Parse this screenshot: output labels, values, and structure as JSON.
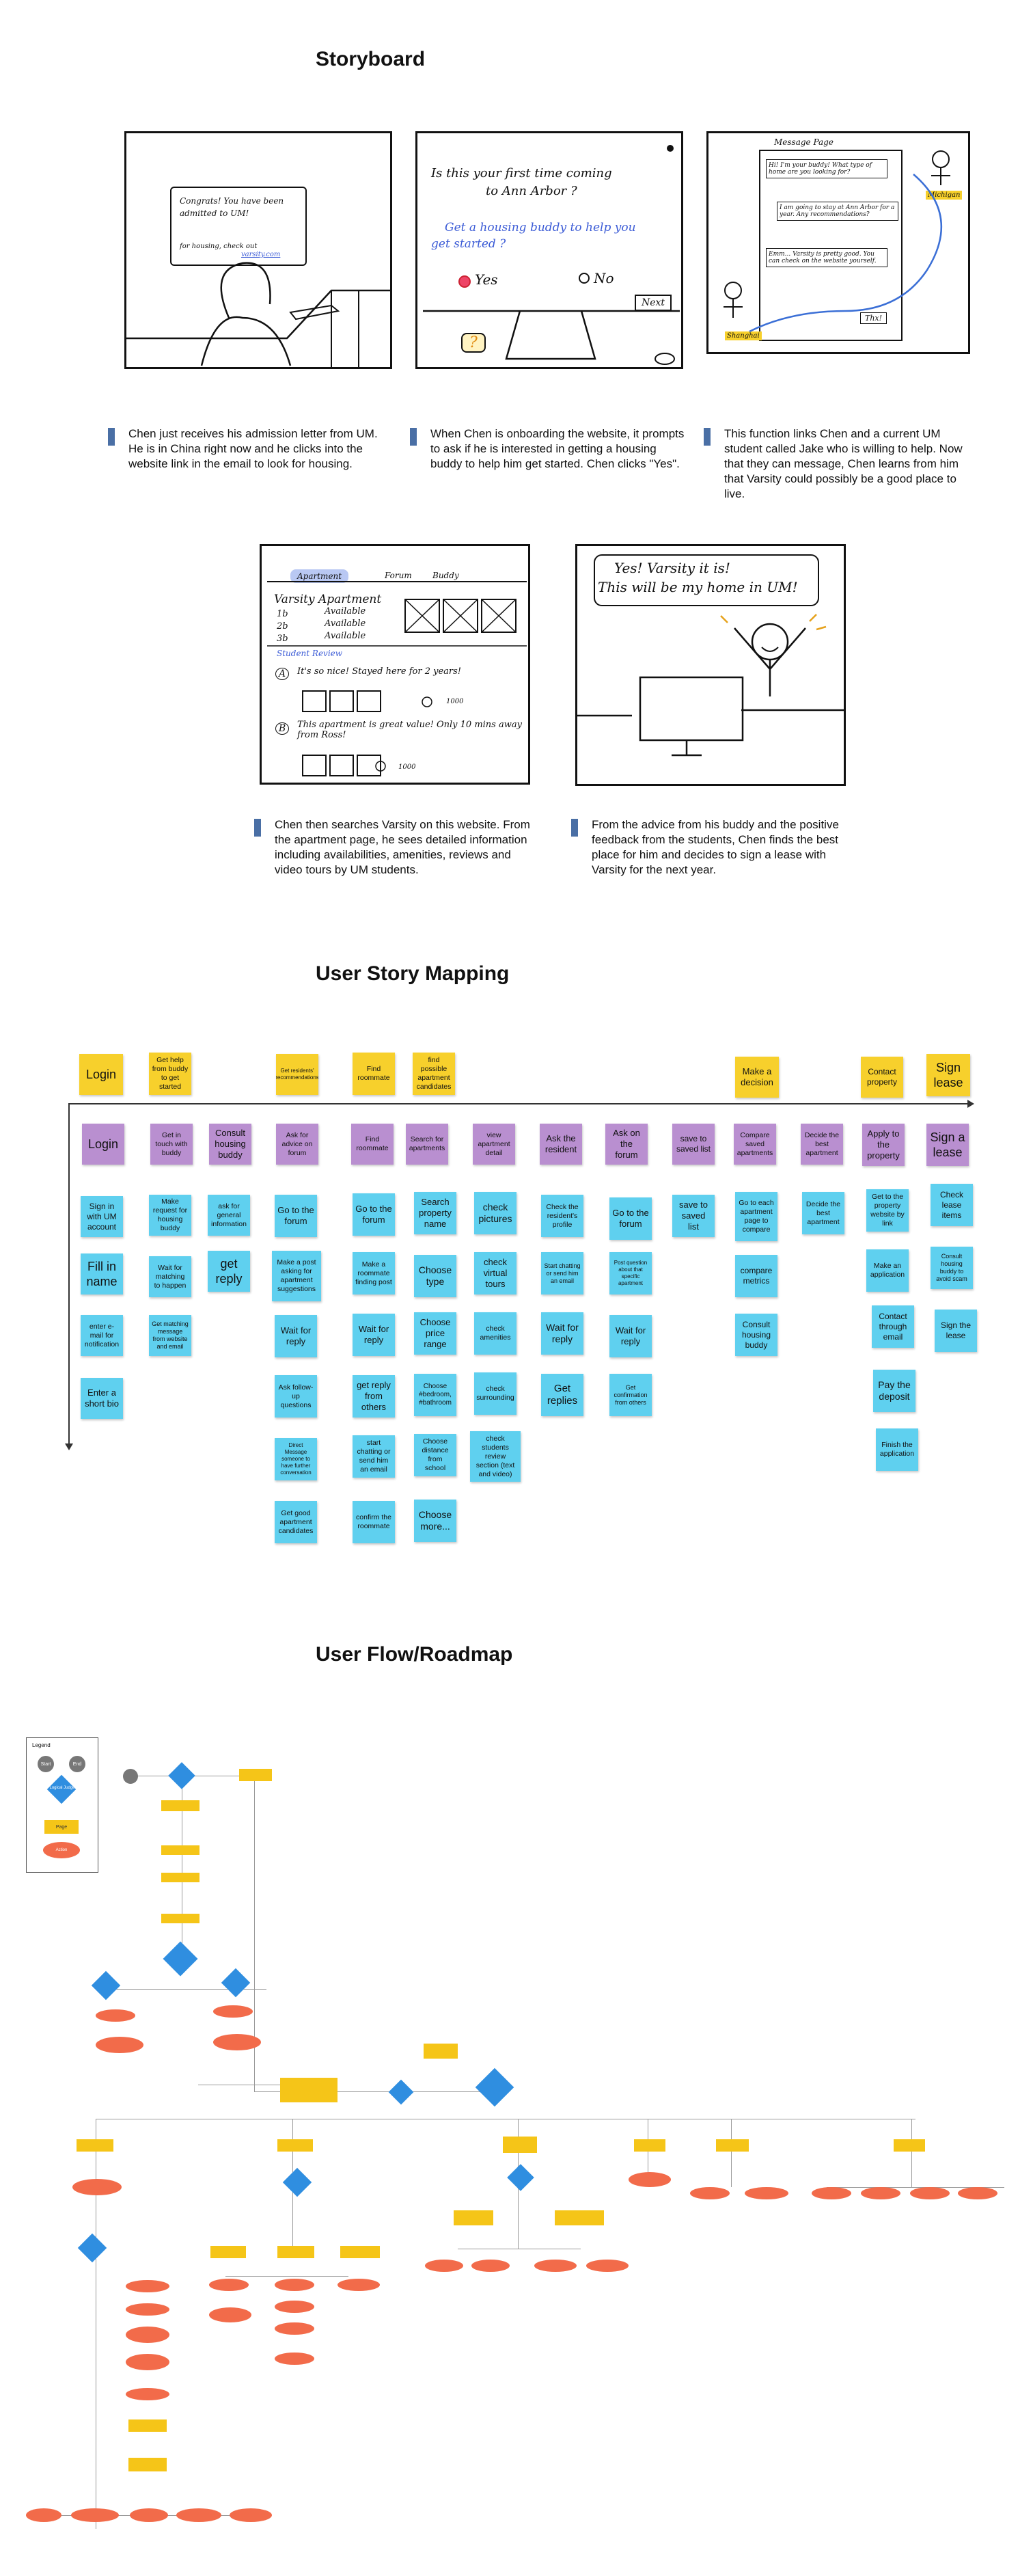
{
  "sections": {
    "storyboard": "Storyboard",
    "mapping": "User Story Mapping",
    "flow": "User Flow/Roadmap"
  },
  "storyboard": {
    "frame1": {
      "letter_line1": "Congrats! You have been",
      "letter_line2": "admitted to UM!",
      "letter_line3": "for housing, check out",
      "letter_link": "varsity.com"
    },
    "frame2": {
      "q1": "Is this your first time coming",
      "q2": "to Ann Arbor ?",
      "blue1": "Get a housing buddy to help you",
      "blue2": "get started ?",
      "yes": "Yes",
      "no": "No",
      "next": "Next",
      "help": "?"
    },
    "frame3": {
      "title": "Message Page",
      "m1": "Hi! I'm your buddy! What type of home are you looking for?",
      "m2": "I am going to stay at Ann Arbor for a year. Any recommendations?",
      "m3": "Emm... Varsity is pretty good. You can check on the website yourself.",
      "thx": "Thx!",
      "michigan": "Michigan",
      "shanghai": "Shanghai"
    },
    "frame4": {
      "tab1": "Apartment",
      "tab2": "Forum",
      "tab3": "Buddy",
      "name": "Varsity Apartment",
      "r1": "1b",
      "r2": "2b",
      "r3": "3b",
      "avail": "Available",
      "review": "Student Review",
      "a": "A",
      "rev_a": "It's so nice! Stayed here for 2 years!",
      "b": "B",
      "rev_b": "This apartment is great value! Only 10 mins away from Ross!",
      "likes": "1000"
    },
    "frame5": {
      "l1": "Yes! Varsity it is!",
      "l2": "This will be my home in UM!"
    },
    "captions": [
      "Chen just receives his admission letter from UM. He is in China right now and he clicks into the website link in the email to look for housing.",
      "When Chen is onboarding the website, it prompts to ask if he is interested in getting a housing buddy to help him get started. Chen clicks \"Yes\".",
      "This function links Chen and a current UM student called Jake who is willing to help. Now that they can message, Chen learns from him that Varsity could possibly be a good place to live.",
      "Chen then searches Varsity on this website. From the apartment page, he sees detailed information including availabilities, amenities, reviews and video tours by UM students.",
      "From the advice from his buddy and the positive feedback from the students, Chen finds the best place for him and decides to sign a lease with Varsity for the next year."
    ]
  },
  "mapping": {
    "top": [
      "Login",
      "Get help from buddy to get started",
      "Get residents' recommendations",
      "Find roommate",
      "find possible apartment candidates",
      "Make a decision",
      "Contact property",
      "Sign lease"
    ],
    "activities": [
      "Login",
      "Get in touch with buddy",
      "Consult housing buddy",
      "Ask for advice on forum",
      "Find roommate",
      "Search for apartments",
      "view apartment detail",
      "Ask the resident",
      "Ask on the forum",
      "save to saved list",
      "Compare saved apartments",
      "Decide the best apartment",
      "Apply to the property",
      "Sign a lease"
    ],
    "col1": [
      "Sign in with UM account",
      "Fill in name",
      "enter e-mail for notification",
      "Enter a short bio"
    ],
    "col2": [
      "Make request for housing buddy",
      "Wait for matching to happen",
      "Get matching message from website and email"
    ],
    "col3": [
      "ask for general information",
      "get reply"
    ],
    "col4": [
      "Go to the forum",
      "Make a post asking for apartment suggestions",
      "Wait for reply",
      "Ask follow-up questions",
      "Direct Message someone to have further conversation",
      "Get good apartment candidates"
    ],
    "col5": [
      "Go to the forum",
      "Make a roommate finding post",
      "Wait for reply",
      "get reply from others",
      "start chatting or send him an email",
      "confirm the roommate"
    ],
    "col6": [
      "Search property name",
      "Choose type",
      "Choose price range",
      "Choose #bedroom, #bathroom",
      "Choose distance from school",
      "Choose more..."
    ],
    "col7": [
      "check pictures",
      "check virtual tours",
      "check amenities",
      "check surrounding",
      "check students review section (text and video)"
    ],
    "col8": [
      "Check the resident's profile",
      "Start chatting or send him an email",
      "Wait for reply",
      "Get replies"
    ],
    "col9": [
      "Go to the forum",
      "Post question about that specific apartment",
      "Wait for reply",
      "Get confirmation from others"
    ],
    "col10": [
      "save to saved list"
    ],
    "col11": [
      "Go to each apartment page to compare",
      "compare metrics",
      "Consult housing buddy"
    ],
    "col12": [
      "Decide the best apartment"
    ],
    "col13": [
      "Get to the property website by link",
      "Make an application",
      "Contact through email",
      "Pay the deposit",
      "Finish the application"
    ],
    "col14": [
      "Check lease items",
      "Consult housing buddy to avoid scam",
      "Sign the lease"
    ]
  },
  "flow": {
    "legend_title": "Legend",
    "start": "Start",
    "end": "End",
    "logical": "Logical Judge",
    "action": "Action",
    "page": "Page"
  }
}
